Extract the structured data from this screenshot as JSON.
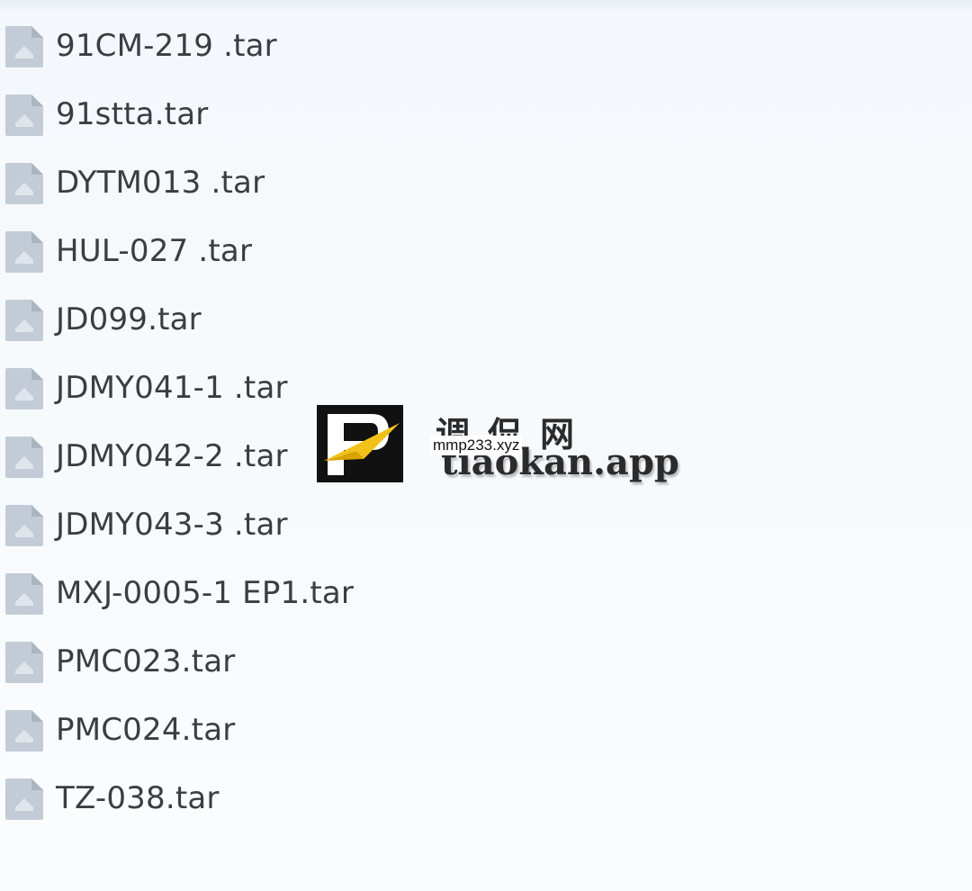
{
  "files": [
    {
      "name": "91CM-219 .tar",
      "icon": "archive-file-icon"
    },
    {
      "name": "91stta.tar",
      "icon": "archive-file-icon"
    },
    {
      "name": "DYTM013 .tar",
      "icon": "archive-file-icon"
    },
    {
      "name": "HUL-027 .tar",
      "icon": "archive-file-icon"
    },
    {
      "name": "JD099.tar",
      "icon": "archive-file-icon"
    },
    {
      "name": "JDMY041-1 .tar",
      "icon": "archive-file-icon"
    },
    {
      "name": "JDMY042-2 .tar",
      "icon": "archive-file-icon"
    },
    {
      "name": "JDMY043-3 .tar",
      "icon": "archive-file-icon"
    },
    {
      "name": "MXJ-0005-1 EP1.tar",
      "icon": "archive-file-icon"
    },
    {
      "name": "PMC023.tar",
      "icon": "archive-file-icon"
    },
    {
      "name": "PMC024.tar",
      "icon": "archive-file-icon"
    },
    {
      "name": "TZ-038.tar",
      "icon": "archive-file-icon"
    }
  ],
  "watermark": {
    "cn_text": "调侃网",
    "latin_text": "tiaokan.app",
    "tag_text": "mmp233.xyz"
  },
  "colors": {
    "text": "#3a3d42",
    "icon": "#b9c4cf",
    "logo_black": "#111111",
    "logo_yellow": "#f2c21b"
  }
}
